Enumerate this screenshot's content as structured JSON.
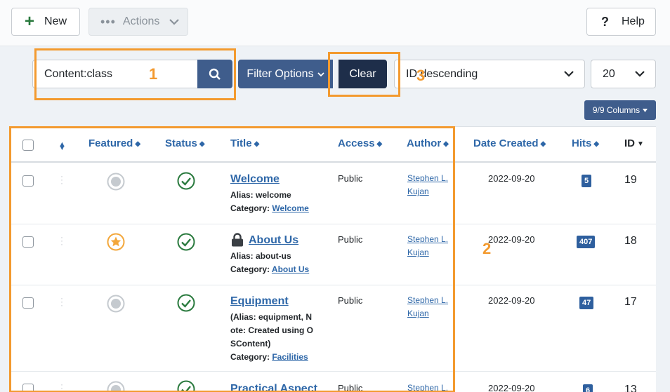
{
  "toolbar": {
    "new_label": "New",
    "actions_label": "Actions",
    "help_label": "Help"
  },
  "filter": {
    "search_value": "Content:class",
    "filter_options_label": "Filter Options",
    "clear_label": "Clear",
    "ordering_value": "ID descending",
    "limit_value": "20",
    "columns_label": "9/9 Columns"
  },
  "table": {
    "headers": {
      "featured": "Featured",
      "status": "Status",
      "title": "Title",
      "access": "Access",
      "author": "Author",
      "date_created": "Date Created",
      "hits": "Hits",
      "id": "ID"
    },
    "rows": [
      {
        "title": "Welcome",
        "alias": "Alias: welcome",
        "category_prefix": "Category: ",
        "category": "Welcome",
        "access": "Public",
        "author_line1": "Stephen L.",
        "author_line2": "Kujan",
        "date": "2022-09-20",
        "hits": "5",
        "id": "19",
        "featured": false,
        "locked": false
      },
      {
        "title": "About Us",
        "alias": "Alias: about-us",
        "category_prefix": "Category: ",
        "category": "About Us",
        "access": "Public",
        "author_line1": "Stephen L.",
        "author_line2": "Kujan",
        "date": "2022-09-20",
        "hits": "407",
        "id": "18",
        "featured": true,
        "locked": true
      },
      {
        "title": "Equipment",
        "alias_line1": "(Alias: equipment, N",
        "alias_line2": "ote: Created using O",
        "alias_line3": "SContent)",
        "category_prefix": "Category: ",
        "category": "Facilities",
        "access": "Public",
        "author_line1": "Stephen L.",
        "author_line2": "Kujan",
        "date": "2022-09-20",
        "hits": "47",
        "id": "17",
        "featured": false,
        "locked": false
      },
      {
        "title": "Practical Aspect",
        "access": "Public",
        "author_line1": "Stephen L.",
        "date": "2022-09-20",
        "hits": "6",
        "id": "13",
        "featured": false,
        "locked": false
      }
    ]
  },
  "annotations": {
    "one": "1",
    "two": "2",
    "three": "3"
  },
  "colors": {
    "accent": "#3f5d8c",
    "link": "#2e67a8",
    "success": "#2a7a3e",
    "featured": "#f3a73b",
    "annotation": "#f39a2f"
  }
}
